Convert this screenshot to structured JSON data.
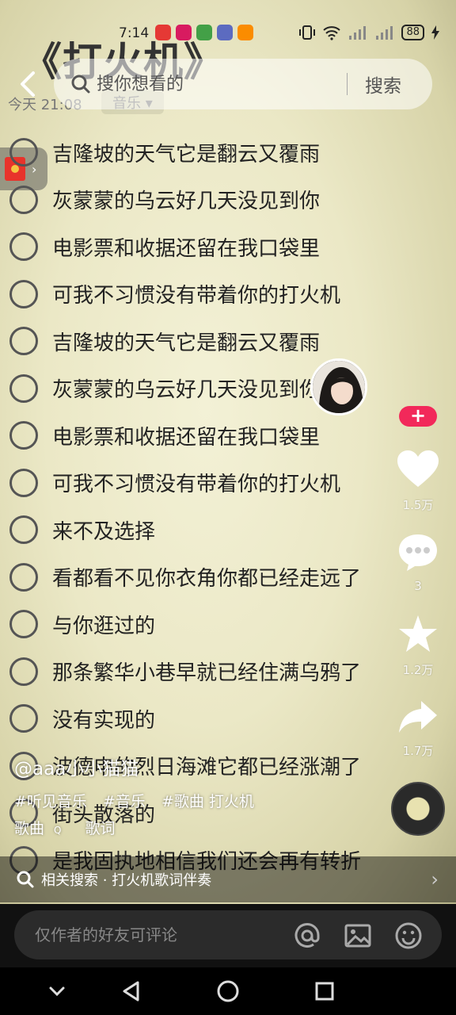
{
  "status_bar": {
    "time": "7:14",
    "battery": "88"
  },
  "document": {
    "title": "《打火机》",
    "meta_time": "今天 21:08",
    "meta_category": "音乐"
  },
  "search": {
    "placeholder": "搜你想看的",
    "submit_label": "搜索"
  },
  "lyrics": [
    "吉隆坡的天气它是翻云又覆雨",
    "灰蒙蒙的乌云好几天没见到你",
    "电影票和收据还留在我口袋里",
    "可我不习惯没有带着你的打火机",
    "吉隆坡的天气它是翻云又覆雨",
    "灰蒙蒙的乌云好几天没见到你",
    "电影票和收据还留在我口袋里",
    "可我不习惯没有带着你的打火机",
    "来不及选择",
    "看都看不见你衣角你都已经走远了",
    "与你逛过的",
    "那条繁华小巷早就已经住满乌鸦了",
    "没有实现的",
    "波德申的烈日海滩它都已经涨潮了",
    "街头散落的",
    "是我固执地相信我们还会再有转折"
  ],
  "rail": {
    "likes": "1.5万",
    "comments": "3",
    "favorites": "1.2万",
    "shares": "1.7万"
  },
  "post": {
    "author": "@aaa小小猫猫",
    "hashtags": [
      "#听见音乐",
      "#音乐",
      "#歌曲 打火机"
    ],
    "lyric_tags": [
      "歌曲",
      "歌词"
    ]
  },
  "related": {
    "text": "相关搜索 · 打火机歌词伴奏"
  },
  "comment": {
    "placeholder": "仅作者的好友可评论"
  },
  "colors": {
    "follow_button": "#f2295a",
    "background": "#ebe8c6"
  }
}
